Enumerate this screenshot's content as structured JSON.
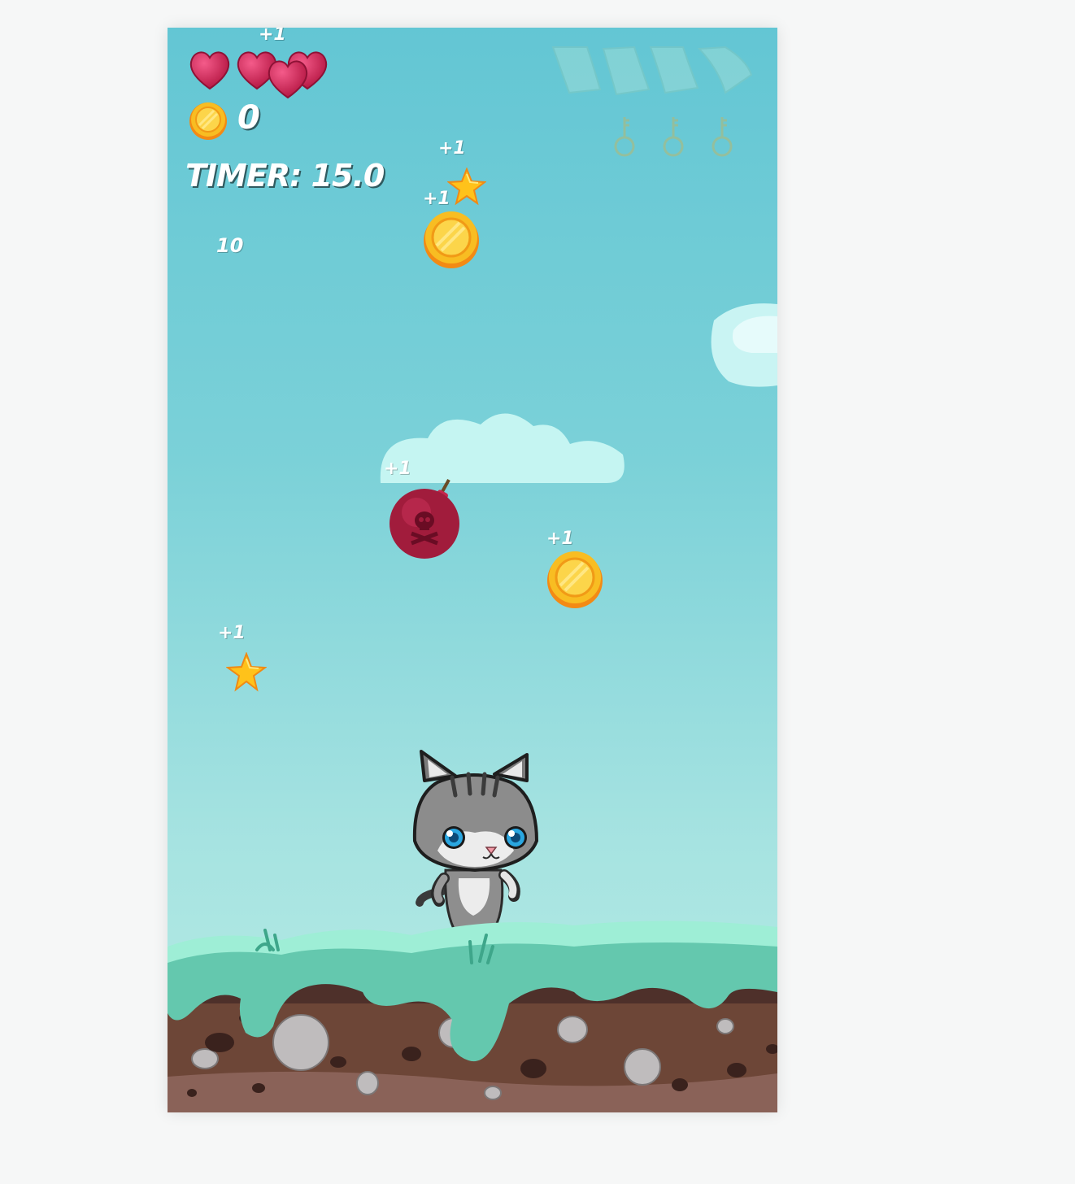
{
  "hud": {
    "lives": 4,
    "coin_count": "0",
    "timer_label": "TIMER: 15.0",
    "floating_score": "10",
    "bonus_label": "+1"
  },
  "collectibles": {
    "scrolls": 4,
    "keys": 3
  },
  "items": [
    {
      "type": "star",
      "label": "+1"
    },
    {
      "type": "coin",
      "label": "+1"
    },
    {
      "type": "bomb",
      "label": "+1"
    },
    {
      "type": "coin",
      "label": "+1"
    },
    {
      "type": "star",
      "label": "+1"
    }
  ],
  "player": {
    "character": "grey-tabby-kitten"
  },
  "colors": {
    "heart": "#d6245d",
    "coin": "#f7b81c",
    "star": "#ffc21a",
    "bomb": "#a11c3c",
    "grass": "#7fdcc4",
    "soil": "#6d4637"
  }
}
